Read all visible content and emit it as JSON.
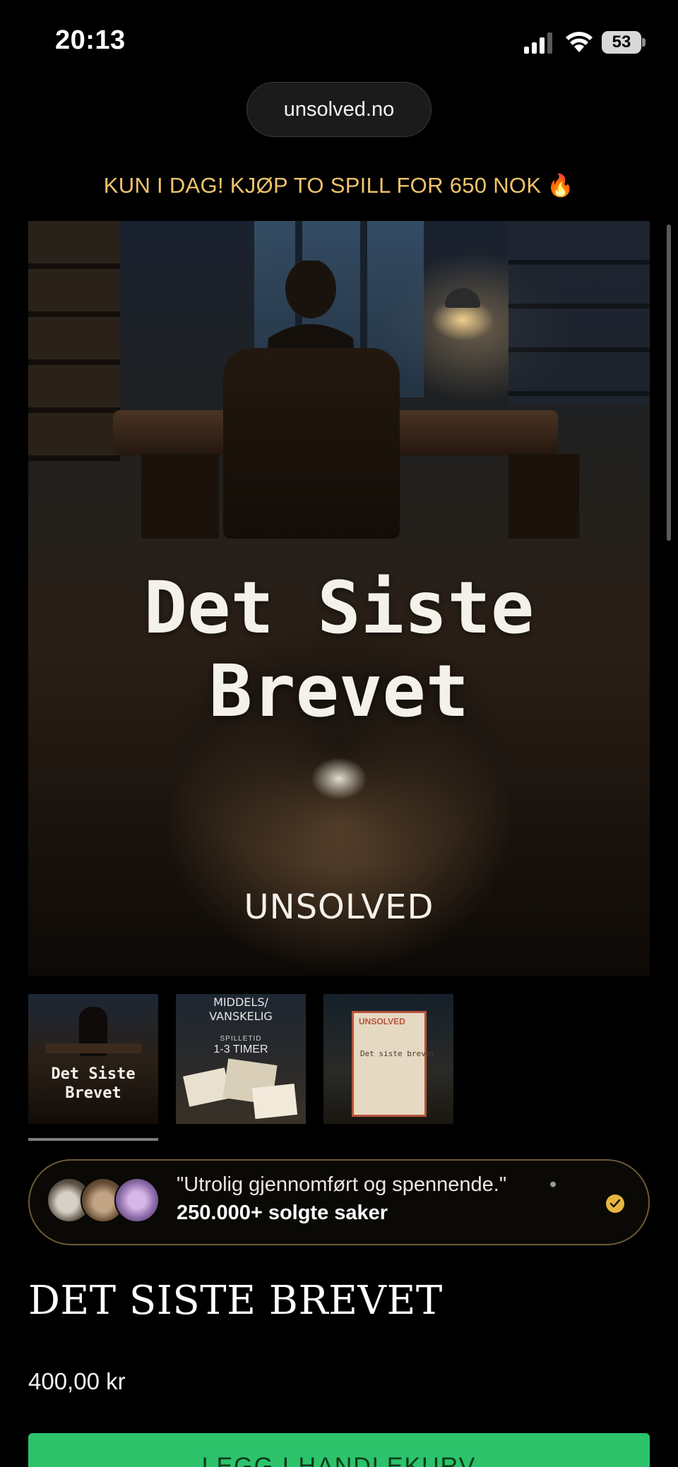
{
  "status_bar": {
    "time": "20:13",
    "battery": "53",
    "icons": [
      "signal-icon",
      "wifi-icon",
      "battery-icon"
    ]
  },
  "browser": {
    "url": "unsolved.no"
  },
  "promo": {
    "text": "KUN I DAG! KJØP TO SPILL FOR 650 NOK",
    "emoji": "🔥",
    "color": "#f1c46b"
  },
  "hero": {
    "title_line1": "Det Siste",
    "title_line2": "Brevet",
    "brand": "UNSOLVED"
  },
  "thumbnails": [
    {
      "title_line1": "Det Siste",
      "title_line2": "Brevet",
      "active": true
    },
    {
      "label_top_line1": "MIDDELS/",
      "label_top_line2": "VANSKELIG",
      "label_sub": "SPILLETID",
      "label_time": "1-3 TIMER",
      "active": false
    },
    {
      "doc_brand": "UNSOLVED",
      "doc_title": "Det siste brevet",
      "active": false
    }
  ],
  "review": {
    "quote": "\"Utrolig gjennomført og spennende.\"",
    "separator": "•",
    "sales": "250.000+ solgte saker",
    "accent": "#e6b63f"
  },
  "product": {
    "title": "DET SISTE BREVET",
    "price": "400,00 kr"
  },
  "cta": {
    "label": "LEGG I HANDLEKURV",
    "color": "#2cc36b"
  }
}
